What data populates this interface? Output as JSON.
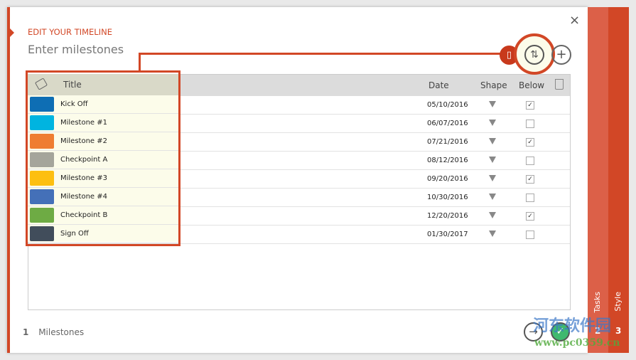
{
  "header": {
    "kicker": "EDIT YOUR TIMELINE",
    "title": "Enter milestones",
    "close": "×"
  },
  "columns": {
    "title": "Title",
    "date": "Date",
    "shape": "Shape",
    "below": "Below"
  },
  "rows": [
    {
      "title": "Kick Off",
      "date": "05/10/2016",
      "below": true,
      "color": "#0e6eb4"
    },
    {
      "title": "Milestone #1",
      "date": "06/07/2016",
      "below": false,
      "color": "#00b4e0"
    },
    {
      "title": "Milestone #2",
      "date": "07/21/2016",
      "below": true,
      "color": "#ef7d31"
    },
    {
      "title": "Checkpoint A",
      "date": "08/12/2016",
      "below": false,
      "color": "#a5a59b"
    },
    {
      "title": "Milestone #3",
      "date": "09/20/2016",
      "below": true,
      "color": "#fdbf10"
    },
    {
      "title": "Milestone #4",
      "date": "10/30/2016",
      "below": false,
      "color": "#4470b8"
    },
    {
      "title": "Checkpoint B",
      "date": "12/20/2016",
      "below": true,
      "color": "#6eab44"
    },
    {
      "title": "Sign Off",
      "date": "01/30/2017",
      "below": false,
      "color": "#414d5b"
    }
  ],
  "footer": {
    "step": "1",
    "label": "Milestones"
  },
  "tabs": [
    {
      "label": "Tasks",
      "num": "2"
    },
    {
      "label": "Style",
      "num": "3"
    }
  ],
  "icons": {
    "paste": "clipboard-icon",
    "swap": "swap-icon",
    "add": "plus-icon",
    "delete": "trash-icon",
    "next": "arrow-right-icon",
    "done": "check-icon"
  },
  "colors": {
    "accent": "#d24726",
    "tab2": "#dc6048",
    "highlight": "#fcfcea"
  },
  "watermark": {
    "cn": "河东软件园",
    "url": "www.pc0359.cn"
  }
}
